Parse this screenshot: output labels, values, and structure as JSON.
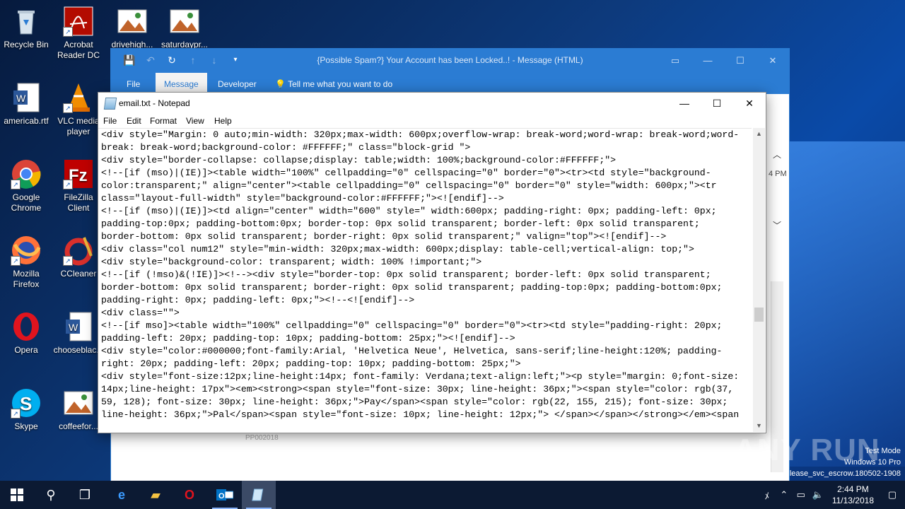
{
  "desktop": {
    "icons": [
      {
        "label": "Recycle Bin"
      },
      {
        "label": "Acrobat Reader DC"
      },
      {
        "label": "drivehigh..."
      },
      {
        "label": "saturdaypr..."
      },
      {
        "label": "americab.rtf"
      },
      {
        "label": "VLC media player"
      },
      {
        "label": "Google Chrome"
      },
      {
        "label": "FileZilla Client"
      },
      {
        "label": "Mozilla Firefox"
      },
      {
        "label": "CCleaner"
      },
      {
        "label": "Opera"
      },
      {
        "label": "chooseblac..."
      },
      {
        "label": "Skype"
      },
      {
        "label": "coffeefor..."
      }
    ]
  },
  "outlook": {
    "title": "{Possible Spam?} Your Account has been Locked..! - Message (HTML)",
    "tabs": [
      "File",
      "Message",
      "Developer"
    ],
    "active_tab": "Message",
    "tell_me": "Tell me what you want to do",
    "time_partial": "4 PM",
    "footer_code": "PP002018"
  },
  "notepad": {
    "title": "email.txt - Notepad",
    "menu": [
      "File",
      "Edit",
      "Format",
      "View",
      "Help"
    ],
    "lines": [
      "<div style=\"Margin: 0 auto;min-width: 320px;max-width: 600px;overflow-wrap: break-word;word-wrap: break-word;word-",
      "break: break-word;background-color: #FFFFFF;\" class=\"block-grid \">",
      "<div style=\"border-collapse: collapse;display: table;width: 100%;background-color:#FFFFFF;\">",
      "<!--[if (mso)|(IE)]><table width=\"100%\" cellpadding=\"0\" cellspacing=\"0\" border=\"0\"><tr><td style=\"background-",
      "color:transparent;\" align=\"center\"><table cellpadding=\"0\" cellspacing=\"0\" border=\"0\" style=\"width: 600px;\"><tr",
      "class=\"layout-full-width\" style=\"background-color:#FFFFFF;\"><![endif]-->",
      "<!--[if (mso)|(IE)]><td align=\"center\" width=\"600\" style=\" width:600px; padding-right: 0px; padding-left: 0px;",
      "padding-top:0px; padding-bottom:0px; border-top: 0px solid transparent; border-left: 0px solid transparent;",
      "border-bottom: 0px solid transparent; border-right: 0px solid transparent;\" valign=\"top\"><![endif]-->",
      "<div class=\"col num12\" style=\"min-width: 320px;max-width: 600px;display: table-cell;vertical-align: top;\">",
      "<div style=\"background-color: transparent; width: 100% !important;\">",
      "<!--[if (!mso)&(!IE)]><!--><div style=\"border-top: 0px solid transparent; border-left: 0px solid transparent;",
      "border-bottom: 0px solid transparent; border-right: 0px solid transparent; padding-top:0px; padding-bottom:0px;",
      "padding-right: 0px; padding-left: 0px;\"><!--<![endif]-->",
      "<div class=\"\">",
      "<!--[if mso]><table width=\"100%\" cellpadding=\"0\" cellspacing=\"0\" border=\"0\"><tr><td style=\"padding-right: 20px;",
      "padding-left: 20px; padding-top: 10px; padding-bottom: 25px;\"><![endif]-->",
      "<div style=\"color:#000000;font-family:Arial, 'Helvetica Neue', Helvetica, sans-serif;line-height:120%; padding-",
      "right: 20px; padding-left: 20px; padding-top: 10px; padding-bottom: 25px;\">",
      "<div style=\"font-size:12px;line-height:14px; font-family: Verdana;text-align:left;\"><p style=\"margin: 0;font-size:",
      "14px;line-height: 17px\"><em><strong><span style=\"font-size: 30px; line-height: 36px;\"><span style=\"color: rgb(37,",
      "59, 128); font-size: 30px; line-height: 36px;\">Pay</span><span style=\"color: rgb(22, 155, 215); font-size: 30px;",
      "line-height: 36px;\">Pal</span><span style=\"font-size: 10px; line-height: 12px;\"> </span></span></strong></em><span"
    ]
  },
  "watermark": {
    "brand": "ANY RUN",
    "mode": [
      "Test Mode",
      "Windows 10 Pro",
      "lease_svc_escrow.180502-1908"
    ]
  },
  "taskbar": {
    "time": "2:44 PM",
    "date": "11/13/2018"
  }
}
